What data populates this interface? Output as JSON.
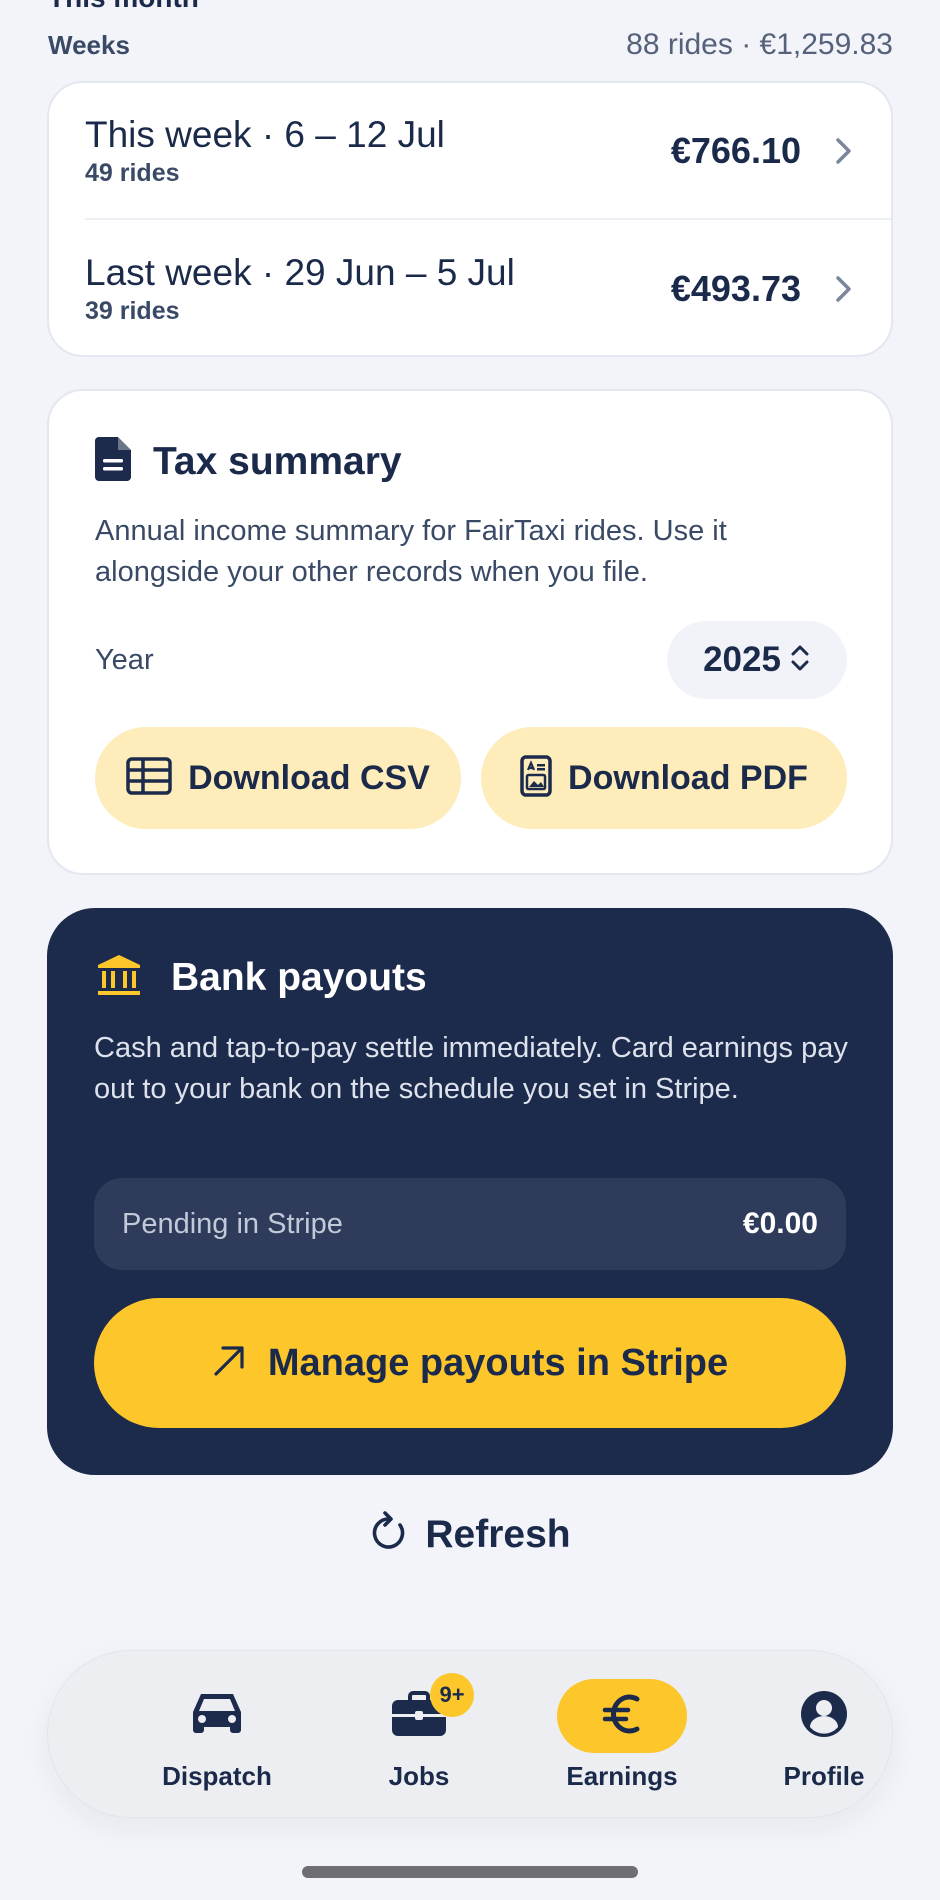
{
  "section": {
    "clipped_heading": "This month",
    "weeks_label": "Weeks",
    "weeks_summary": "88 rides · €1,259.83"
  },
  "weeks": [
    {
      "title": "This week · 6 – 12 Jul",
      "rides": "49 rides",
      "amount": "€766.10"
    },
    {
      "title": "Last week · 29 Jun – 5 Jul",
      "rides": "39 rides",
      "amount": "€493.73"
    }
  ],
  "tax": {
    "icon": "document-icon",
    "title": "Tax summary",
    "description": "Annual income summary for FairTaxi rides. Use it alongside your other records when you file.",
    "year_label": "Year",
    "year_value": "2025",
    "download_csv": "Download CSV",
    "download_pdf": "Download PDF"
  },
  "bank": {
    "icon": "bank-icon",
    "title": "Bank payouts",
    "description": "Cash and tap-to-pay settle immediately. Card earnings pay out to your bank on the schedule you set in Stripe.",
    "pending_label": "Pending in Stripe",
    "pending_value": "€0.00",
    "manage_label": "Manage payouts in Stripe"
  },
  "refresh_label": "Refresh",
  "tabs": [
    {
      "label": "Dispatch",
      "icon": "car-icon"
    },
    {
      "label": "Jobs",
      "icon": "briefcase-icon",
      "badge": "9+"
    },
    {
      "label": "Earnings",
      "icon": "euro-icon",
      "active": true
    },
    {
      "label": "Profile",
      "icon": "profile-icon"
    }
  ],
  "colors": {
    "background": "#f2f4f9",
    "navy": "#1c2a4b",
    "accent_yellow": "#fdc62a",
    "light_yellow": "#feecba"
  }
}
